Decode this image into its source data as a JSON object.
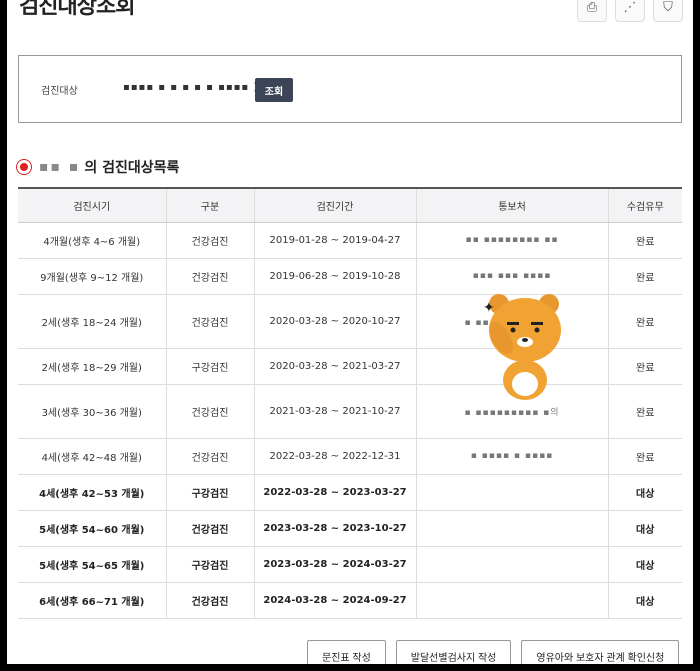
{
  "page": {
    "title": "검진대상조회"
  },
  "top_icons": [
    {
      "name": "print-icon",
      "glyph": "⎙"
    },
    {
      "name": "share-icon",
      "glyph": "⋰"
    },
    {
      "name": "bookmark-icon",
      "glyph": "⛉"
    }
  ],
  "search": {
    "label": "검진대상",
    "value": "▪▪▪▪ ▪ ▪ ▪ ▪ ▪   ▪▪▪▪ )",
    "button": "조회"
  },
  "list": {
    "owner": "▪▪ ▪",
    "title_suffix": "의 검진대상목록"
  },
  "table": {
    "headers": [
      "검진시기",
      "구분",
      "검진기간",
      "통보처",
      "수검유무"
    ],
    "rows": [
      {
        "period": "4개월(생후 4~6 개월)",
        "type": "건강검진",
        "range": "2019-01-28 ~ 2019-04-27",
        "notify": "▪▪ ▪▪▪▪▪▪▪▪ ▪▪",
        "status": "완료",
        "bold": false,
        "target": false,
        "height": 36
      },
      {
        "period": "9개월(생후 9~12 개월)",
        "type": "건강검진",
        "range": "2019-06-28 ~ 2019-10-28",
        "notify": "▪▪▪ ▪▪▪ ▪▪▪▪",
        "status": "완료",
        "bold": false,
        "target": false,
        "height": 36
      },
      {
        "period": "2세(생후 18~24 개월)",
        "type": "건강검진",
        "range": "2020-03-28 ~ 2020-10-27",
        "notify": "▪ ▪▪▪▪▪▪▪▪▪ ▪의",
        "status": "완료",
        "bold": false,
        "target": false,
        "height": 54
      },
      {
        "period": "2세(생후 18~29 개월)",
        "type": "구강검진",
        "range": "2020-03-28 ~ 2021-03-27",
        "notify": "",
        "status": "완료",
        "bold": false,
        "target": false,
        "height": 36
      },
      {
        "period": "3세(생후 30~36 개월)",
        "type": "건강검진",
        "range": "2021-03-28 ~ 2021-10-27",
        "notify": "▪ ▪▪▪▪▪▪▪▪▪ ▪의",
        "status": "완료",
        "bold": false,
        "target": false,
        "height": 54
      },
      {
        "period": "4세(생후 42~48 개월)",
        "type": "건강검진",
        "range": "2022-03-28 ~ 2022-12-31",
        "notify": "▪ ▪▪▪▪ ▪ ▪▪▪▪",
        "status": "완료",
        "bold": false,
        "target": false,
        "height": 36
      },
      {
        "period": "4세(생후 42~53 개월)",
        "type": "구강검진",
        "range": "2022-03-28 ~ 2023-03-27",
        "notify": "",
        "status": "대상",
        "bold": true,
        "target": true,
        "height": 36
      },
      {
        "period": "5세(생후 54~60 개월)",
        "type": "건강검진",
        "range": "2023-03-28 ~ 2023-10-27",
        "notify": "",
        "status": "대상",
        "bold": true,
        "target": true,
        "height": 36
      },
      {
        "period": "5세(생후 54~65 개월)",
        "type": "구강검진",
        "range": "2023-03-28 ~ 2024-03-27",
        "notify": "",
        "status": "대상",
        "bold": true,
        "target": true,
        "height": 36
      },
      {
        "period": "6세(생후 66~71 개월)",
        "type": "건강검진",
        "range": "2024-03-28 ~ 2024-09-27",
        "notify": "",
        "status": "대상",
        "bold": true,
        "target": true,
        "height": 36
      }
    ]
  },
  "buttons": [
    "문진표 작성",
    "발달선별검사지 작성",
    "영유아와 보호자 관계 확인신청"
  ]
}
